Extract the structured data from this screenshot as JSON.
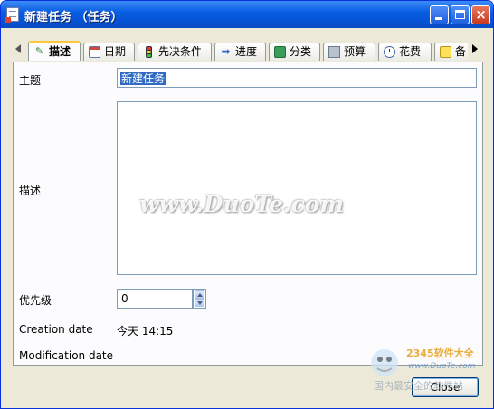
{
  "window": {
    "title": "新建任务 （任务）",
    "buttons": {
      "minimize": "minimize",
      "maximize": "maximize",
      "close": "×"
    }
  },
  "tabs": [
    {
      "label": "描述",
      "icon": "pencil-icon",
      "active": true
    },
    {
      "label": "日期",
      "icon": "calendar-icon"
    },
    {
      "label": "先决条件",
      "icon": "traffic-light-icon"
    },
    {
      "label": "进度",
      "icon": "arrow-right-icon"
    },
    {
      "label": "分类",
      "icon": "box-icon"
    },
    {
      "label": "预算",
      "icon": "calculator-icon"
    },
    {
      "label": "花费",
      "icon": "clock-icon"
    },
    {
      "label": "备",
      "icon": "note-icon"
    }
  ],
  "form": {
    "subject_label": "主题",
    "subject_value": "新建任务",
    "description_label": "描述",
    "description_value": "",
    "priority_label": "优先级",
    "priority_value": "0",
    "creation_label": "Creation date",
    "creation_value": "今天 14:15",
    "modification_label": "Modification date",
    "modification_value": ""
  },
  "footer": {
    "close_label": "Close"
  },
  "overlay": {
    "watermark_text": "www.DuoTe.com",
    "logo_brand": "2345软件大全",
    "logo_url": "www.DuoTe.com",
    "logo_caption": "国内最安全的软件站"
  },
  "colors": {
    "titlebar": "#0a5fe3",
    "selection": "#316ac5",
    "active_tab_accent": "#ffc83c"
  }
}
